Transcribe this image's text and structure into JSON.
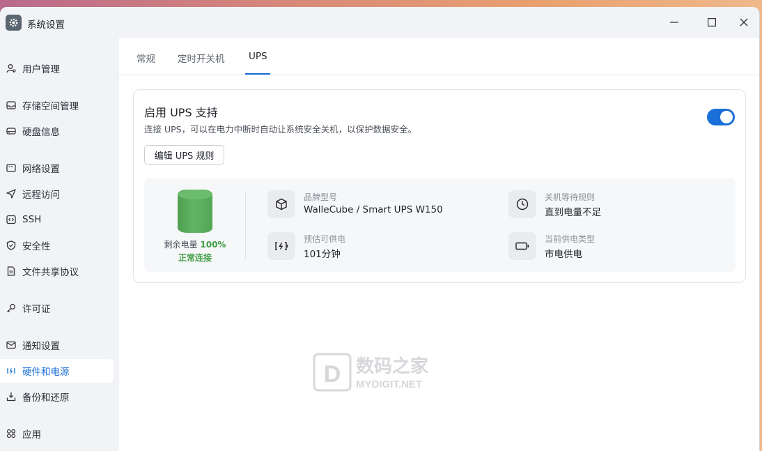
{
  "window": {
    "title": "系统设置"
  },
  "sidebar": {
    "items": [
      {
        "label": "用户管理",
        "icon": "user-icon"
      },
      {
        "label": "存储空间管理",
        "icon": "storage-icon"
      },
      {
        "label": "硬盘信息",
        "icon": "disk-icon"
      },
      {
        "label": "网络设置",
        "icon": "network-icon"
      },
      {
        "label": "远程访问",
        "icon": "send-icon"
      },
      {
        "label": "SSH",
        "icon": "code-icon"
      },
      {
        "label": "安全性",
        "icon": "shield-icon"
      },
      {
        "label": "文件共享协议",
        "icon": "file-icon"
      },
      {
        "label": "许可证",
        "icon": "key-icon"
      },
      {
        "label": "通知设置",
        "icon": "mail-icon"
      },
      {
        "label": "硬件和电源",
        "icon": "battery-charging-icon",
        "active": true
      },
      {
        "label": "备份和还原",
        "icon": "download-tray-icon"
      },
      {
        "label": "应用",
        "icon": "apps-grid-icon"
      }
    ]
  },
  "tabs": [
    {
      "label": "常规"
    },
    {
      "label": "定时开关机"
    },
    {
      "label": "UPS",
      "active": true
    }
  ],
  "ups": {
    "title": "启用 UPS 支持",
    "description": "连接 UPS，可以在电力中断时自动让系统安全关机，以保护数据安全。",
    "enabled": true,
    "edit_button": "编辑 UPS 规则",
    "battery_label": "剩余电量",
    "battery_percent": "100%",
    "battery_level": 1.0,
    "connection_status": "正常连接",
    "model_label": "品牌型号",
    "model_value": "WalleCube / Smart UPS W150",
    "shutdown_rule_label": "关机等待规则",
    "shutdown_rule_value": "直到电量不足",
    "runtime_label": "预估可供电",
    "runtime_value": "101分钟",
    "power_type_label": "当前供电类型",
    "power_type_value": "市电供电"
  },
  "watermark": {
    "text": "数码之家",
    "sub": "MYDIGIT.NET"
  },
  "colors": {
    "accent": "#1a6fd8",
    "battery_green": "#5cb05e",
    "status_green": "#3f9d43"
  }
}
